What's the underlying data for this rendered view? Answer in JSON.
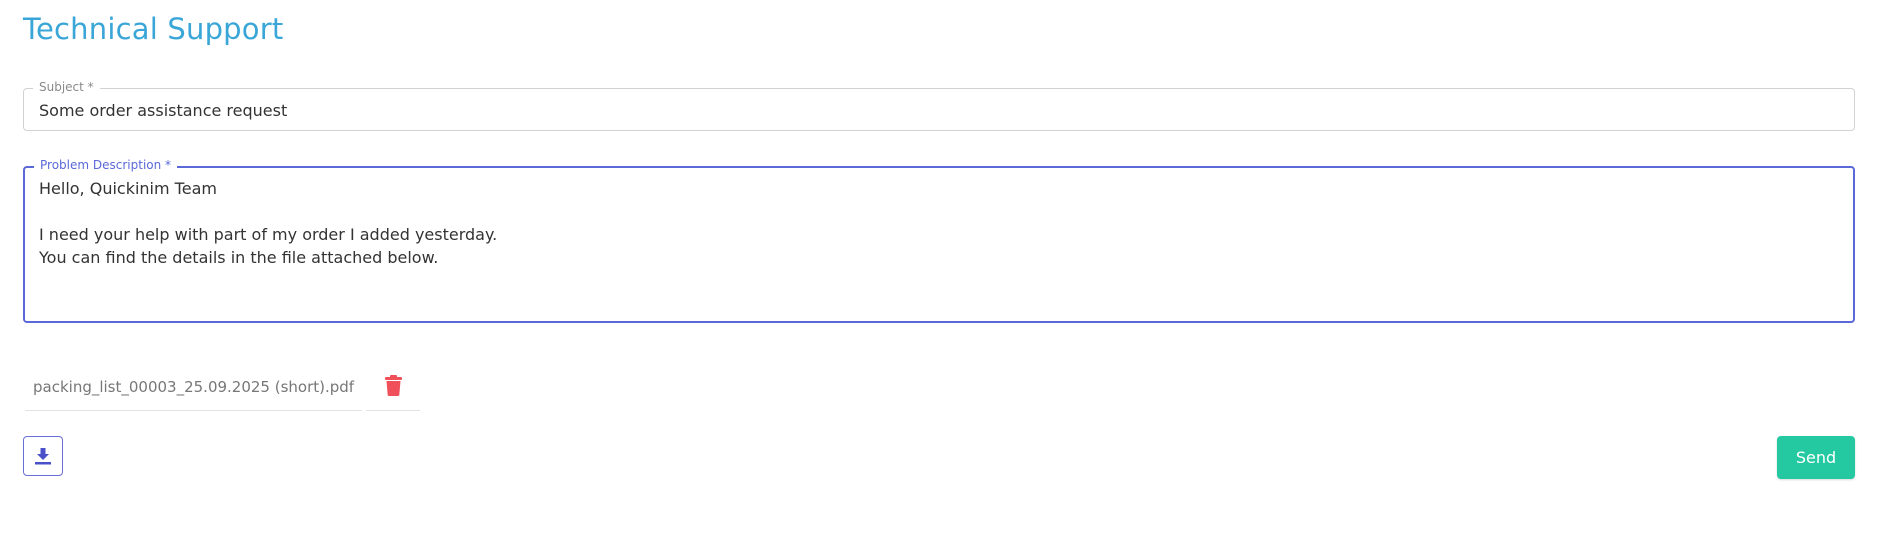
{
  "page": {
    "title": "Technical Support"
  },
  "form": {
    "subject": {
      "label": "Subject *",
      "value": "Some order assistance request"
    },
    "description": {
      "label": "Problem Description *",
      "value": "Hello, Quickinim Team\n\nI need your help with part of my order I added yesterday.\nYou can find the details in the file attached below."
    }
  },
  "attachment": {
    "filename": "packing_list_00003_25.09.2025 (short).pdf",
    "delete_icon": "trash-icon",
    "delete_color": "#f0505a"
  },
  "actions": {
    "upload_icon": "download-arrow-icon",
    "send_label": "Send"
  },
  "colors": {
    "title": "#3aa6d8",
    "focus_border": "#5b68d8",
    "send_button": "#24c9a2"
  }
}
